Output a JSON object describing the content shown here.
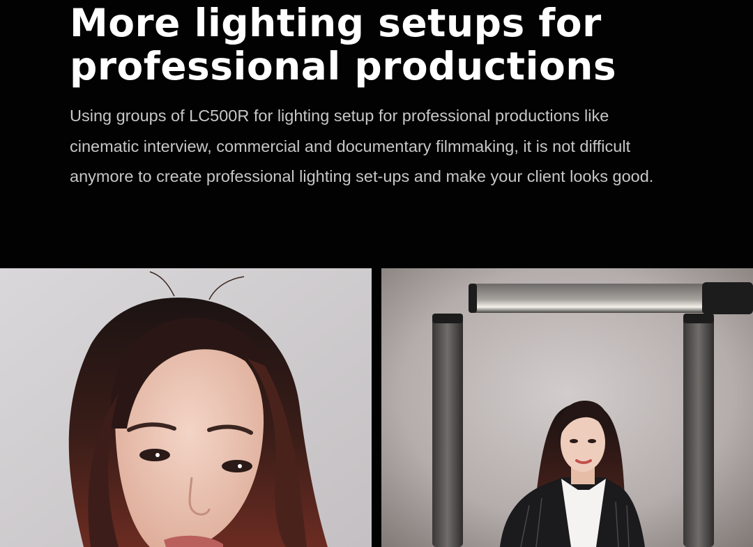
{
  "headline": {
    "line1": "More lighting setups for",
    "line2": "professional productions"
  },
  "body": "Using groups of LC500R for lighting setup for professional productions like cinematic interview, commercial and documentary filmmaking, it is not difficult anymore to create professional lighting set-ups and make your client looks good.",
  "colors": {
    "background": "#020202",
    "headline": "#ffffff",
    "body_text": "#c7c7c7"
  },
  "images": [
    {
      "name": "close-up-portrait-photo"
    },
    {
      "name": "lighting-setup-photo"
    }
  ]
}
